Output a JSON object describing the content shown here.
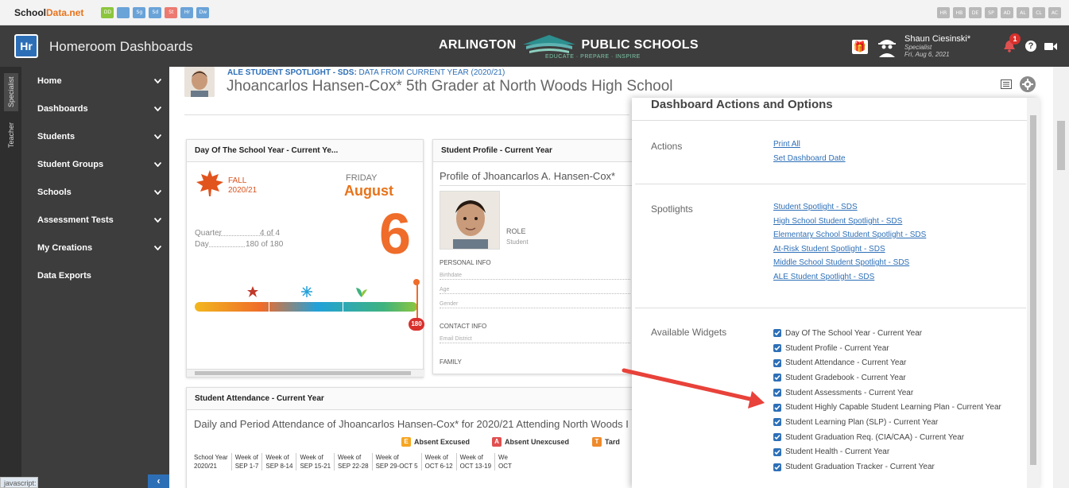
{
  "brand": {
    "part1": "School",
    "part2": "Data.net"
  },
  "top_tiny_icons_left": [
    {
      "label": "DD",
      "color": "#8cc63e"
    },
    {
      "label": "",
      "color": "#6aa3d8"
    },
    {
      "label": "Sg",
      "color": "#6aa3d8"
    },
    {
      "label": "Sd",
      "color": "#6aa3d8"
    },
    {
      "label": "St",
      "color": "#ec7a70"
    },
    {
      "label": "Hr",
      "color": "#6aa3d8"
    },
    {
      "label": "Dw",
      "color": "#6aa3d8"
    }
  ],
  "top_tiny_icons_right": [
    "HR",
    "HB",
    "DE",
    "SP",
    "AD",
    "AL",
    "CL",
    "AC"
  ],
  "header": {
    "app_badge": "Hr",
    "app_title": "Homeroom Dashboards",
    "logo_left": "ARLINGTON",
    "logo_right": "PUBLIC SCHOOLS",
    "logo_tagline": "EDUCATE · PREPARE · INSPIRE",
    "user_name": "Shaun Ciesinski*",
    "user_role": "Specialist",
    "user_date": "Fri, Aug 6, 2021",
    "notif_count": "1",
    "help": "?"
  },
  "vtabs": [
    "Specialist",
    "Teacher"
  ],
  "sidebar": {
    "items": [
      {
        "label": "Home",
        "chevron": true
      },
      {
        "label": "Dashboards",
        "chevron": true
      },
      {
        "label": "Students",
        "chevron": true
      },
      {
        "label": "Student Groups",
        "chevron": true
      },
      {
        "label": "Schools",
        "chevron": true
      },
      {
        "label": "Assessment Tests",
        "chevron": true
      },
      {
        "label": "My Creations",
        "chevron": true
      },
      {
        "label": "Data Exports",
        "chevron": false
      }
    ],
    "collapse": "‹"
  },
  "status_bar": "javascript:",
  "spotlight": {
    "label_bold": "ALE STUDENT SPOTLIGHT - SDS:",
    "label_rest": " DATA FROM CURRENT YEAR (2020/21)",
    "title": "Jhoancarlos Hansen-Cox* 5th Grader at North Woods High School"
  },
  "day_widget": {
    "title": "Day Of The School Year - Current Ye...",
    "season": "FALL",
    "year": "2020/21",
    "weekday": "FRIDAY",
    "month": "August",
    "day_number": "6",
    "quarter_label": "Quarter",
    "quarter_value": "4 of 4",
    "day_label": "Day",
    "day_value": "180 of 180",
    "progress_badge": "180"
  },
  "profile_widget": {
    "title": "Student Profile - Current Year",
    "profile_title": "Profile of Jhoancarlos A. Hansen-Cox*",
    "role_label": "ROLE",
    "role_value": "Student",
    "personal_info": "PERSONAL INFO",
    "birthdate": "Birthdate",
    "age": "Age",
    "gender": "Gender",
    "contact_info": "CONTACT INFO",
    "email": "Email District",
    "family": "FAMILY"
  },
  "attendance_widget": {
    "title": "Student Attendance - Current Year",
    "subtitle": "Daily and Period Attendance of Jhoancarlos Hansen-Cox* for 2020/21 Attending North Woods I",
    "legend": [
      {
        "code": "E",
        "label": "Absent Excused",
        "color": "#f5a623"
      },
      {
        "code": "A",
        "label": "Absent Unexcused",
        "color": "#e05050"
      },
      {
        "code": "T",
        "label": "Tard",
        "color": "#ef8a2a"
      }
    ],
    "columns": [
      {
        "top": "School Year",
        "bottom": "2020/21"
      },
      {
        "top": "Week of",
        "bottom": "SEP 1-7"
      },
      {
        "top": "Week of",
        "bottom": "SEP 8-14"
      },
      {
        "top": "Week of",
        "bottom": "SEP 15-21"
      },
      {
        "top": "Week of",
        "bottom": "SEP 22-28"
      },
      {
        "top": "Week of",
        "bottom": "SEP 29-OCT 5"
      },
      {
        "top": "Week of",
        "bottom": "OCT 6-12"
      },
      {
        "top": "Week of",
        "bottom": "OCT 13-19"
      },
      {
        "top": "We",
        "bottom": "OCT"
      }
    ]
  },
  "panel": {
    "title": "Dashboard Actions and Options",
    "actions_label": "Actions",
    "actions": [
      "Print All",
      "Set Dashboard Date"
    ],
    "spotlights_label": "Spotlights",
    "spotlights": [
      "Student Spotlight - SDS",
      "High School Student Spotlight - SDS",
      "Elementary School Student Spotlight - SDS",
      "At-Risk Student Spotlight - SDS",
      "Middle School Student Spotlight - SDS",
      "ALE Student Spotlight - SDS"
    ],
    "widgets_label": "Available Widgets",
    "widgets": [
      "Day Of The School Year - Current Year",
      "Student Profile - Current Year",
      "Student Attendance - Current Year",
      "Student Gradebook - Current Year",
      "Student Assessments - Current Year",
      "Student Highly Capable Student Learning Plan - Current Year",
      "Student Learning Plan (SLP) - Current Year",
      "Student Graduation Req. (CIA/CAA) - Current Year",
      "Student Health - Current Year",
      "Student Graduation Tracker - Current Year"
    ]
  },
  "colors": {
    "accent": "#2d6fb7",
    "header": "#3d3d3d",
    "orange": "#ef6c2a",
    "arrow": "#e8423a"
  }
}
